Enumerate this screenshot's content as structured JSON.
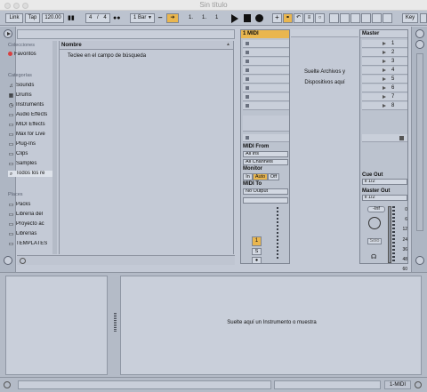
{
  "window": {
    "title": "Sin título"
  },
  "control_bar": {
    "link": "Link",
    "tap": "Tap",
    "tempo": "120.00",
    "sig_num": "4",
    "sig_sep": "/",
    "sig_den": "4",
    "quant": "1 Bar",
    "pos1": "1.",
    "pos2": "1.",
    "pos3": "1",
    "key": "Key"
  },
  "browser": {
    "collections_header": "Colecciones",
    "favorites": "Favoritos",
    "categories_header": "Categorías",
    "categories": [
      "Sounds",
      "Drums",
      "Instruments",
      "Audio Effects",
      "MIDI Effects",
      "Max for Live",
      "Plug-Ins",
      "Clips",
      "Samples",
      "Todos los re"
    ],
    "places_header": "Places",
    "places": [
      "Packs",
      "Librería del",
      "Proyecto ac",
      "Librerías",
      "TEMPLATES"
    ],
    "column_header": "Nombre",
    "hint": "Teclee en el campo de búsqueda"
  },
  "midi_track": {
    "name": "1 MIDI",
    "midi_from_label": "MIDI From",
    "midi_from_value": "All Ins",
    "channel_value": "All Channels",
    "monitor_label": "Monitor",
    "monitor_in": "In",
    "monitor_auto": "Auto",
    "monitor_off": "Off",
    "midi_to_label": "MIDI To",
    "midi_to_value": "No Output",
    "track_number": "1",
    "solo": "S"
  },
  "drop_zone": {
    "text1": "Suelte Archivos y",
    "text2": "Dispositivos aquí"
  },
  "master": {
    "name": "Master",
    "scenes": [
      "1",
      "2",
      "3",
      "4",
      "5",
      "6",
      "7",
      "8"
    ],
    "cue_out_label": "Cue Out",
    "cue_out_value": "ii 1/2",
    "master_out_label": "Master Out",
    "master_out_value": "ii 1/2",
    "volume": "-Inf",
    "solo": "Solo",
    "meter_ticks": [
      "0",
      "6",
      "12",
      "24",
      "36",
      "48",
      "60"
    ]
  },
  "detail": {
    "drop_text": "Suelte aquí un Instrumento o muestra"
  },
  "status": {
    "track_label": "1-MIDI"
  }
}
